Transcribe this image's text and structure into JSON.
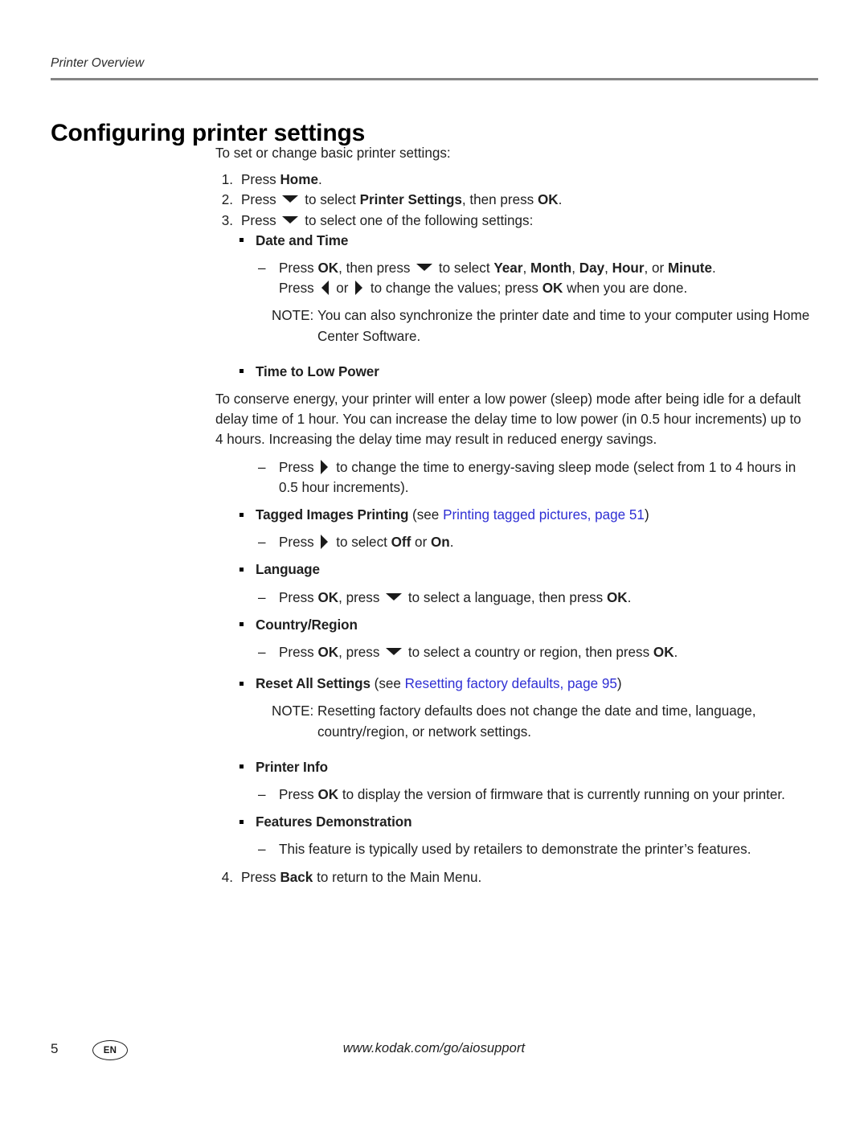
{
  "header": {
    "running_head": "Printer Overview",
    "title": "Configuring printer settings"
  },
  "body": {
    "lead": "To set or change basic printer settings:",
    "step1": {
      "num": "1.",
      "pre": "Press ",
      "key": "Home",
      "post": "."
    },
    "step2": {
      "num": "2.",
      "pre": "Press ",
      "mid": " to select ",
      "target": "Printer Settings",
      "mid2": ", then press ",
      "key": "OK",
      "post": "."
    },
    "step3": {
      "num": "3.",
      "pre": "Press ",
      "post": " to select one of the following settings:"
    },
    "step4": {
      "num": "4.",
      "pre": "Press ",
      "key": "Back",
      "post": " to return to the Main Menu."
    },
    "date_and_time": {
      "heading": "Date and Time",
      "dash": "–",
      "d1_a": "Press ",
      "d1_ok": "OK",
      "d1_b": ", then press ",
      "d1_c": " to select ",
      "d1_year": "Year",
      "d1_sep1": ", ",
      "d1_month": "Month",
      "d1_sep2": ", ",
      "d1_day": "Day",
      "d1_sep3": ", ",
      "d1_hour": "Hour",
      "d1_sep4": ", or ",
      "d1_minute": "Minute",
      "d1_end": ".",
      "d2_a": "Press ",
      "d2_or": " or ",
      "d2_b": " to change the values; press ",
      "d2_ok": "OK",
      "d2_c": " when you are done.",
      "note_label": "NOTE:",
      "note_text": "You can also synchronize the printer date and time to your computer using Home Center Software."
    },
    "time_to_low_power": {
      "heading": "Time to Low Power",
      "paragraph": "To conserve energy, your printer will enter a low power (sleep) mode after being idle for a default delay time of 1 hour. You can increase the delay time to low power (in 0.5 hour increments) up to 4 hours. Increasing the delay time may result in reduced energy savings.",
      "dash": "–",
      "d1_a": "Press ",
      "d1_b": " to change the time to energy-saving sleep mode (select from 1 to 4 hours in 0.5 hour increments)."
    },
    "tagged_images": {
      "heading": "Tagged Images Printing",
      "see_open": " (see ",
      "link": "Printing tagged pictures, page 51",
      "see_close": ")",
      "dash": "–",
      "d1_a": "Press ",
      "d1_b": " to select ",
      "d1_off": "Off",
      "d1_or": " or ",
      "d1_on": "On",
      "d1_end": "."
    },
    "language": {
      "heading": "Language",
      "dash": "–",
      "d1_a": "Press ",
      "d1_ok1": "OK",
      "d1_b": ", press ",
      "d1_c": " to select a language, then press ",
      "d1_ok2": "OK",
      "d1_end": "."
    },
    "country_region": {
      "heading": "Country/Region",
      "dash": "–",
      "d1_a": "Press ",
      "d1_ok1": "OK",
      "d1_b": ", press ",
      "d1_c": " to select a country or region, then press ",
      "d1_ok2": "OK",
      "d1_end": "."
    },
    "reset_all": {
      "heading": "Reset All Settings",
      "see_open": " (see ",
      "link": "Resetting factory defaults, page 95",
      "see_close": ")",
      "note_label": "NOTE:",
      "note_text": "Resetting factory defaults does not change the date and time, language, country/region, or network settings."
    },
    "printer_info": {
      "heading": "Printer Info",
      "dash": "–",
      "d1_a": "Press ",
      "d1_ok": "OK",
      "d1_b": " to display the version of firmware that is currently running on your printer."
    },
    "features_demo": {
      "heading": "Features Demonstration",
      "dash": "–",
      "d1": "This feature is typically used by retailers to demonstrate the printer’s features."
    }
  },
  "footer": {
    "page_number": "5",
    "language_code": "EN",
    "url": "www.kodak.com/go/aiosupport"
  },
  "colors": {
    "link": "#2f2fd4",
    "rule": "#848484",
    "text": "#1f1f1f"
  }
}
